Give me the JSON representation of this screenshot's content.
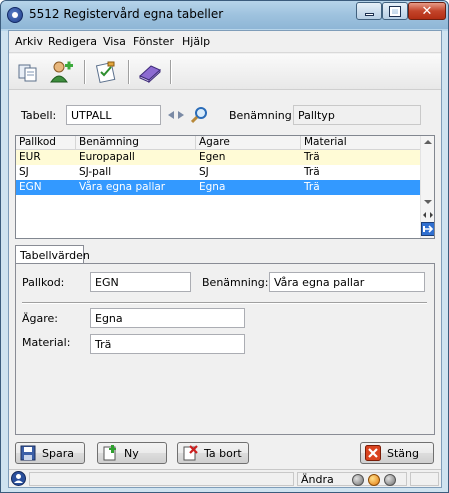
{
  "window": {
    "title": "5512 Registervård egna tabeller",
    "close_glyph": "✕"
  },
  "menu": [
    {
      "label": "Arkiv"
    },
    {
      "label": "Redigera"
    },
    {
      "label": "Visa"
    },
    {
      "label": "Fönster"
    },
    {
      "label": "Hjälp"
    }
  ],
  "toolbar": {
    "icons": [
      "copy-icon",
      "add-user-icon",
      "checklist-icon",
      "books-icon"
    ]
  },
  "header_fields": {
    "tabell_label": "Tabell:",
    "tabell_value": "UTPALL",
    "benamning_label": "Benämning:",
    "benamning_value": "Palltyp"
  },
  "grid": {
    "columns": [
      "Pallkod",
      "Benämning",
      "Ägare",
      "Material"
    ],
    "rows": [
      [
        "EUR",
        "Europapall",
        "Egen",
        "Trä"
      ],
      [
        "SJ",
        "SJ-pall",
        "SJ",
        "Trä"
      ],
      [
        "EGN",
        "Våra egna pallar",
        "Egna",
        "Trä"
      ]
    ],
    "selected_row": 2
  },
  "tab": {
    "label": "Tabellvärden"
  },
  "form": {
    "pallkod_label": "Pallkod:",
    "pallkod_value": "EGN",
    "benamning_label": "Benämning:",
    "benamning_value": "Våra egna pallar",
    "agare_label": "Ägare:",
    "agare_value": "Egna",
    "material_label": "Material:",
    "material_value": "Trä"
  },
  "buttons": {
    "spara": "Spara",
    "ny": "Ny",
    "ta_bort": "Ta bort",
    "stang": "Stäng"
  },
  "status": {
    "mode": "Ändra"
  },
  "colors": {
    "selection": "#3399ff",
    "row_highlight": "#fffbd6"
  }
}
